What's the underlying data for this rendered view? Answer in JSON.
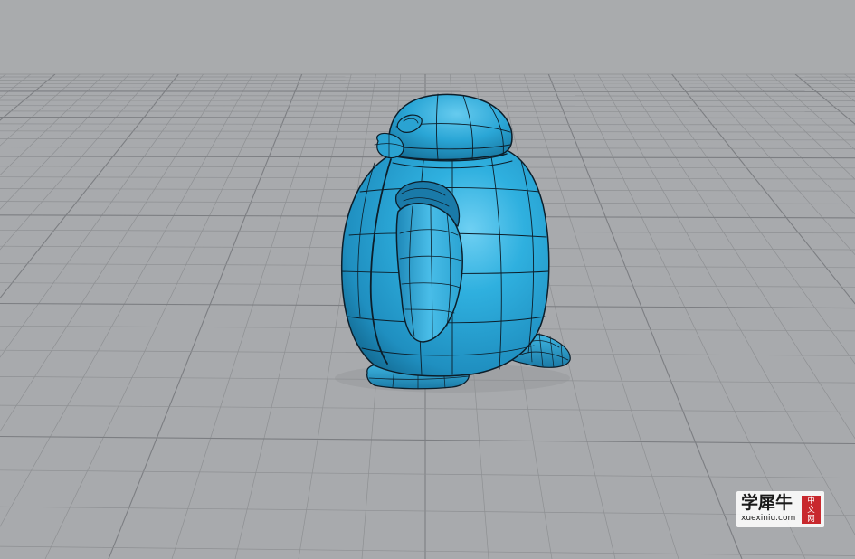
{
  "viewport": {
    "background_color": "#a9abad",
    "ground_color": "#a8aaad",
    "grid_line_color": "#8e9093",
    "grid_major_color": "#7c7e82",
    "model_color": "#2aa3d2",
    "model_highlight": "#7fd2f0",
    "model_shadow": "#13688f",
    "wire_color": "#0c1e2a"
  },
  "model": {
    "name": "penguin-model"
  },
  "watermark": {
    "chinese": "学犀牛",
    "url": "xuexiniu.com",
    "seal": "中文网"
  }
}
